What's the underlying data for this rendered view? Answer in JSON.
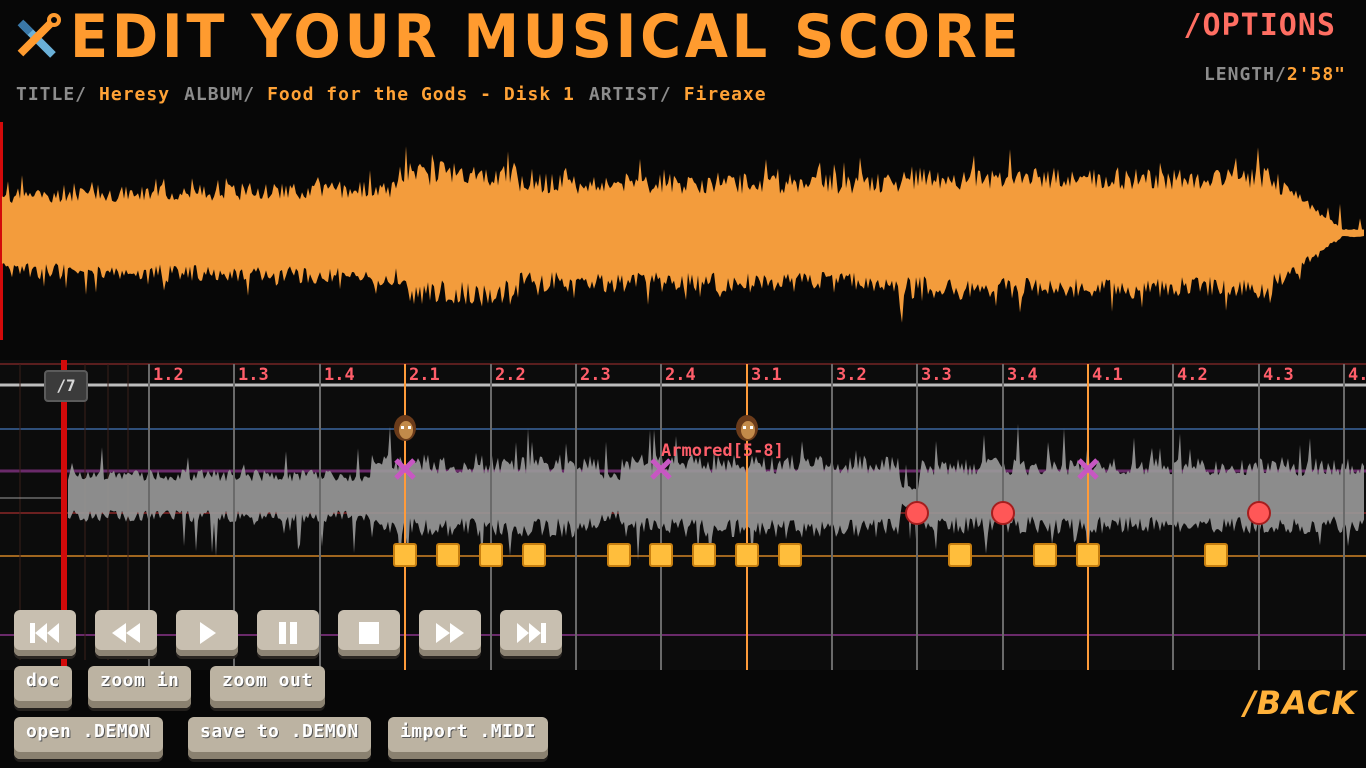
{
  "header": {
    "title": "EDIT YOUR MUSICAL SCORE",
    "options_label": "/OPTIONS",
    "length_key": "LENGTH/",
    "length_value": "2'58\""
  },
  "song": {
    "title_key": "TITLE/",
    "title": "Heresy",
    "album_key": "ALBUM/",
    "album": "Food for the Gods - Disk 1",
    "artist_key": "ARTIST/",
    "artist": "Fireaxe"
  },
  "timeline": {
    "beat_labels": [
      "1.2",
      "1.3",
      "1.4",
      "2.1",
      "2.2",
      "2.3",
      "2.4",
      "3.1",
      "3.2",
      "3.3",
      "3.4",
      "4.1",
      "4.2",
      "4.3",
      "4."
    ],
    "chip_label": "/7",
    "event_label": "Armored[5-8]"
  },
  "transport": {
    "buttons": [
      "skip-to-start",
      "rewind",
      "play",
      "pause",
      "stop",
      "fast-forward",
      "skip-to-end"
    ]
  },
  "actions": {
    "doc": "doc",
    "zoom_in": "zoom in",
    "zoom_out": "zoom out",
    "open": "open .DEMON",
    "save": "save to .DEMON",
    "import": "import .MIDI"
  },
  "back_label": "/BACK",
  "colors": {
    "accent": "#ff9b2f",
    "options": "#ff6e62",
    "beat_label": "#ff5e6a",
    "note_square": "#ffbe3c",
    "note_circle": "#ff5757",
    "note_x": "#c757c2",
    "playhead": "#d20a0a"
  },
  "notes": {
    "x_marks": [
      405,
      661,
      1088
    ],
    "circles": [
      917,
      1003,
      1259
    ],
    "squares": [
      405,
      448,
      491,
      534,
      619,
      661,
      704,
      747,
      790,
      960,
      1045,
      1088,
      1216
    ],
    "heads": [
      405,
      747
    ]
  }
}
